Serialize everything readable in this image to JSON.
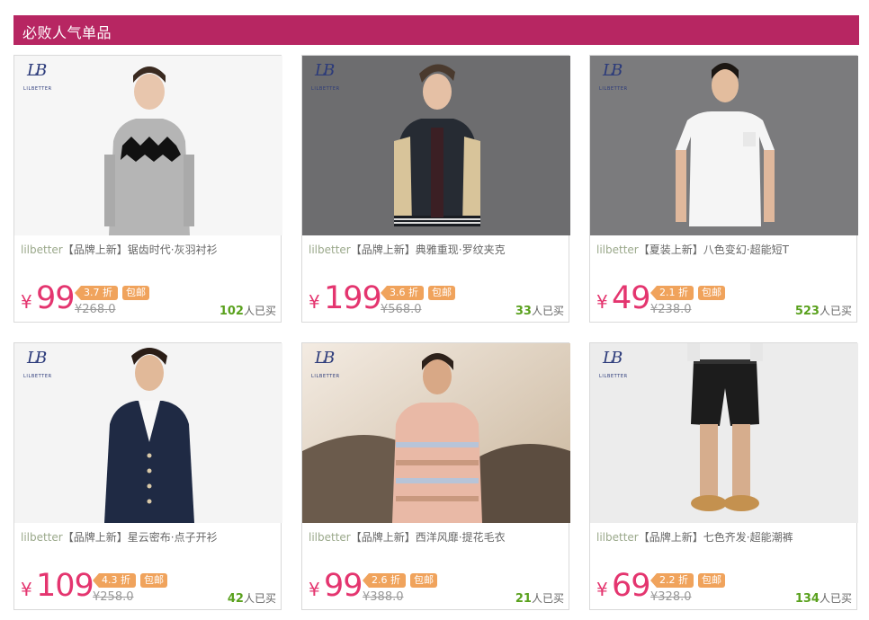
{
  "section": {
    "title": "必败人气单品"
  },
  "colors": {
    "accent": "#b72662",
    "price": "#e4356f",
    "tag": "#f0a35c",
    "sold": "#5aa11e"
  },
  "products": [
    {
      "brand": "lilbetter",
      "category": "【品牌上新】",
      "title": "锯齿时代·灰羽衬衫",
      "yen": "¥",
      "price": "99",
      "discount": "3.7 折",
      "free_shipping": "包邮",
      "original": "¥268.0",
      "sold_count": "102",
      "sold_suffix": "人已买"
    },
    {
      "brand": "lilbetter",
      "category": "【品牌上新】",
      "title": "典雅重现·罗纹夹克",
      "yen": "¥",
      "price": "199",
      "discount": "3.6 折",
      "free_shipping": "包邮",
      "original": "¥568.0",
      "sold_count": "33",
      "sold_suffix": "人已买"
    },
    {
      "brand": "lilbetter",
      "category": "【夏装上新】",
      "title": "八色变幻·超能短T",
      "yen": "¥",
      "price": "49",
      "discount": "2.1 折",
      "free_shipping": "包邮",
      "original": "¥238.0",
      "sold_count": "523",
      "sold_suffix": "人已买"
    },
    {
      "brand": "lilbetter",
      "category": "【品牌上新】",
      "title": "星云密布·点子开衫",
      "yen": "¥",
      "price": "109",
      "discount": "4.3 折",
      "free_shipping": "包邮",
      "original": "¥258.0",
      "sold_count": "42",
      "sold_suffix": "人已买"
    },
    {
      "brand": "lilbetter",
      "category": "【品牌上新】",
      "title": "西洋风靡·提花毛衣",
      "yen": "¥",
      "price": "99",
      "discount": "2.6 折",
      "free_shipping": "包邮",
      "original": "¥388.0",
      "sold_count": "21",
      "sold_suffix": "人已买"
    },
    {
      "brand": "lilbetter",
      "category": "【品牌上新】",
      "title": "七色齐发·超能潮裤",
      "yen": "¥",
      "price": "69",
      "discount": "2.2 折",
      "free_shipping": "包邮",
      "original": "¥328.0",
      "sold_count": "134",
      "sold_suffix": "人已买"
    }
  ],
  "logo": {
    "mark": "LB",
    "wordmark": "LILBETTER"
  }
}
